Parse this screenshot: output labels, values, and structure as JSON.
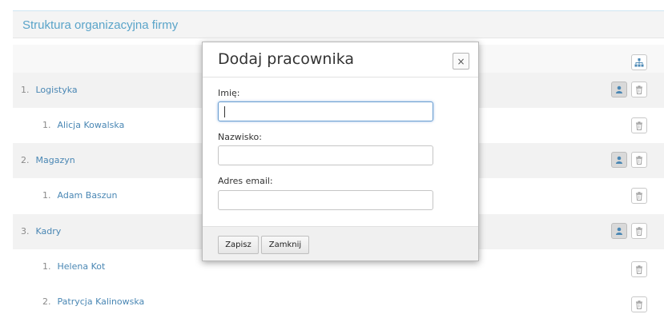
{
  "panel": {
    "title": "Struktura organizacyjna firmy"
  },
  "top_row": {
    "action_icon": "sitemap-icon"
  },
  "rows": [
    {
      "kind": "department",
      "number": "1.",
      "name": "Logistyka"
    },
    {
      "kind": "employee",
      "number": "1.",
      "name": "Alicja Kowalska"
    },
    {
      "kind": "department",
      "number": "2.",
      "name": "Magazyn"
    },
    {
      "kind": "employee",
      "number": "1.",
      "name": "Adam Baszun"
    },
    {
      "kind": "department",
      "number": "3.",
      "name": "Kadry"
    },
    {
      "kind": "employee",
      "number": "1.",
      "name": "Helena Kot"
    },
    {
      "kind": "employee",
      "number": "2.",
      "name": "Patrycja Kalinowska"
    }
  ],
  "icons": {
    "add_employee": "user-icon",
    "delete": "trash-icon"
  },
  "modal": {
    "title": "Dodaj pracownika",
    "close_label": "×",
    "fields": [
      {
        "label": "Imię:",
        "value": ""
      },
      {
        "label": "Nazwisko:",
        "value": ""
      },
      {
        "label": "Adres email:",
        "value": ""
      }
    ],
    "save_label": "Zapisz",
    "close_button_label": "Zamknij"
  },
  "colors": {
    "accent": "#5aa4c9",
    "link": "#4a87b4",
    "department_row_bg": "#f2f2f2",
    "focus_border": "#6a9ed1"
  }
}
